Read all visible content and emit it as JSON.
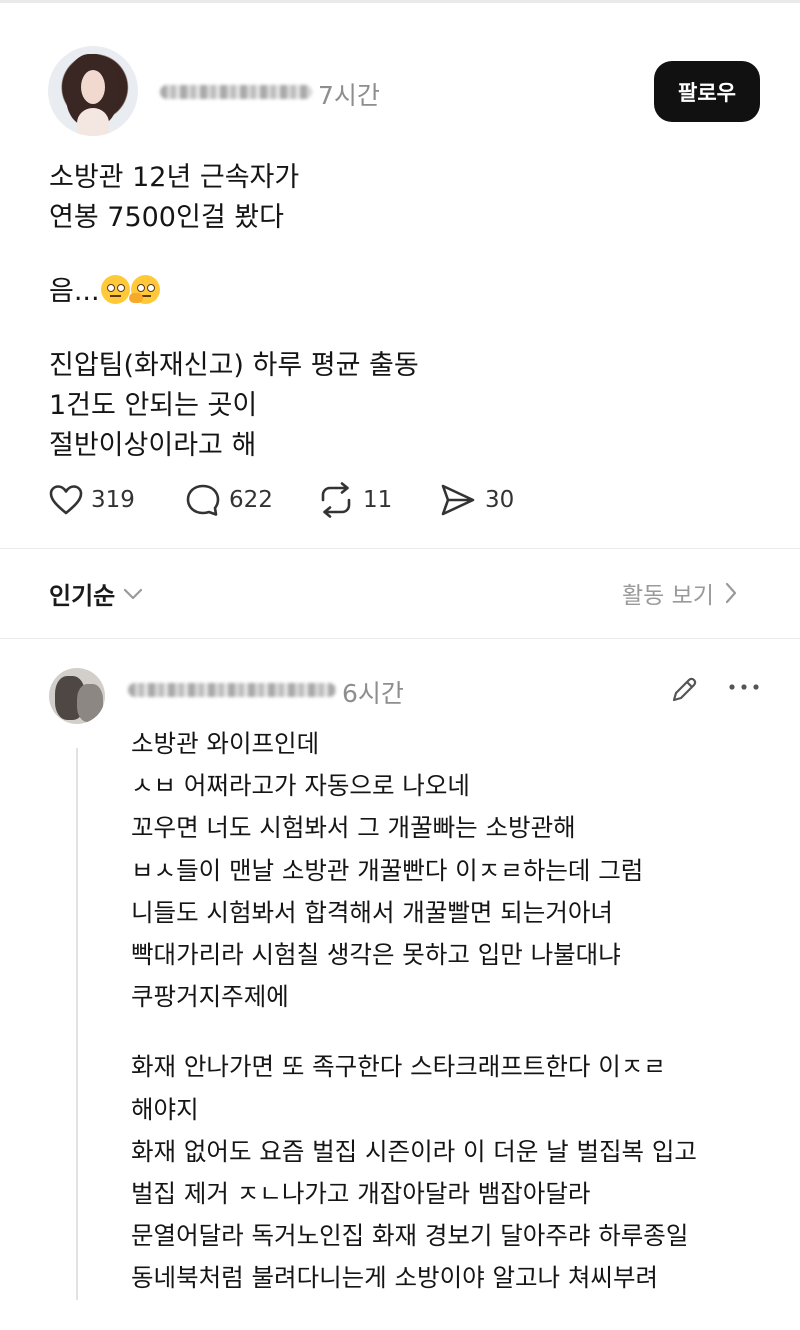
{
  "post": {
    "time": "7시간",
    "follow_label": "팔로우",
    "lines_a": [
      "소방관 12년 근속자가",
      "연봉 7500인걸 봤다"
    ],
    "line_b": "음...",
    "emojis": [
      "rolling-eyes-emoji",
      "thinking-face-emoji"
    ],
    "lines_c": [
      "진압팀(화재신고) 하루 평균 출동",
      "1건도 안되는 곳이",
      "절반이상이라고 해"
    ],
    "stats": {
      "likes": "319",
      "comments": "622",
      "reposts": "11",
      "shares": "30"
    }
  },
  "sort": {
    "label": "인기순",
    "activity_label": "활동 보기"
  },
  "reply": {
    "time": "6시간",
    "para1": [
      "소방관 와이프인데",
      "ㅅㅂ 어쩌라고가 자동으로 나오네",
      "꼬우면 너도 시험봐서 그 개꿀빠는 소방관해",
      "ㅂㅅ들이 맨날 소방관 개꿀빤다 이ㅈㄹ하는데 그럼",
      "니들도 시험봐서 합격해서 개꿀빨면 되는거아녀",
      "빡대가리라 시험칠 생각은 못하고 입만 나불대냐",
      "쿠팡거지주제에"
    ],
    "para2": [
      "화재 안나가면 또 족구한다 스타크래프트한다 이ㅈㄹ",
      "해야지",
      "화재 없어도 요즘 벌집 시즌이라 이 더운 날 벌집복 입고",
      "벌집 제거 ㅈㄴ나가고 개잡아달라 뱀잡아달라",
      "문열어달라 독거노인집 화재 경보기 달아주랴 하루종일",
      "동네북처럼 불려다니는게 소방이야 알고나 쳐씨부려"
    ]
  },
  "icons": [
    "heart-icon",
    "comment-icon",
    "repost-icon",
    "share-icon",
    "chevron-down-icon",
    "chevron-right-icon",
    "edit-icon",
    "more-icon"
  ]
}
